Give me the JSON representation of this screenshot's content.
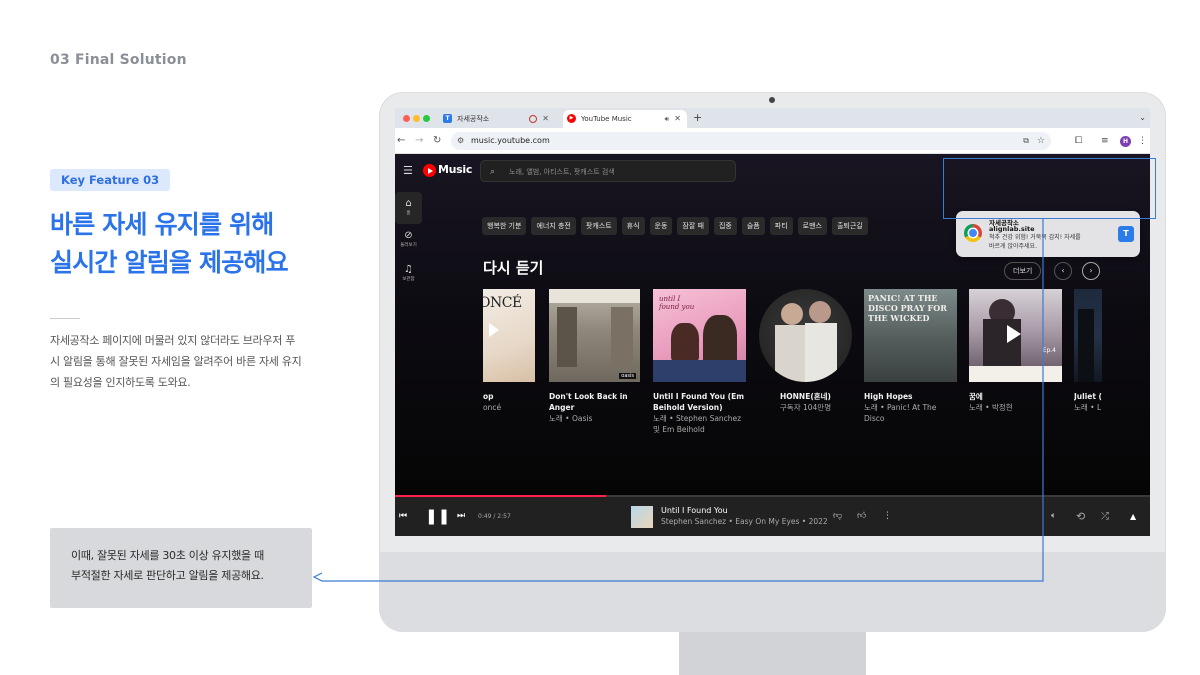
{
  "slide": {
    "section_label": "03  Final Solution",
    "feature_badge": "Key Feature 03",
    "headline": [
      "바른 자세 유지를 위해",
      "실시간 알림을 제공해요"
    ],
    "description": [
      "자세공작소 페이지에 머물러 있지 않더라도 브라우저 푸",
      "시 알림을 통해 잘못된 자세임을 알려주어 바른 자세 유지",
      "의 필요성을 인지하도록 도와요."
    ],
    "callout": [
      "이때, 잘못된 자세를 30초 이상 유지했을 때",
      "부적절한 자세로 판단하고 알림을 제공해요."
    ],
    "accent_color": "#2a73e8"
  },
  "browser": {
    "tabs": [
      {
        "label": "자세공작소",
        "favicon_color": "#2b7be8",
        "favicon_glyph": "T"
      },
      {
        "label": "YouTube Music",
        "favicon_color": "#ff0000",
        "favicon_glyph": "▶"
      }
    ],
    "url": "music.youtube.com",
    "profile_initial": "H"
  },
  "ytmusic": {
    "logo_text": "Music",
    "search_placeholder": "노래, 앨범, 아티스트, 팟캐스트 검색",
    "sidebar": [
      {
        "icon": "home-icon",
        "label": "홈"
      },
      {
        "icon": "explore-icon",
        "label": "둘러보기"
      },
      {
        "icon": "library-icon",
        "label": "보관함"
      }
    ],
    "chips": [
      "행복한 기분",
      "에너지 충전",
      "팟캐스트",
      "휴식",
      "운동",
      "잠잘 때",
      "집중",
      "슬픔",
      "파티",
      "로맨스",
      "출퇴근길"
    ],
    "shelf_title": "다시 듣기",
    "more_label": "더보기",
    "cards": [
      {
        "title": "op",
        "subtitle": "oncé",
        "cover_text": "ONCÉ"
      },
      {
        "title": "Don't Look Back in Anger",
        "subtitle": "노래 • Oasis",
        "cover_text": "oasis"
      },
      {
        "title": "Until I Found You (Em Beihold Version)",
        "subtitle": "노래 • Stephen Sanchez 및 Em Beihold",
        "cover_text": "until I found you"
      },
      {
        "title": "HONNE(혼네)",
        "subtitle": "구독자 104만명",
        "cover_text": ""
      },
      {
        "title": "High Hopes",
        "subtitle": "노래 • Panic! At The Disco",
        "cover_text": "PANIC! AT THE DISCO PRAY FOR THE WICKED"
      },
      {
        "title": "꿈에",
        "subtitle": "노래 • 박정현",
        "cover_text": "Ep.4"
      },
      {
        "title": "Juliet (",
        "subtitle": "노래 • L",
        "cover_text": ""
      }
    ],
    "player": {
      "time": "0:49 / 2:57",
      "title": "Until I Found You",
      "subtitle": "Stephen Sanchez • Easy On My Eyes • 2022",
      "progress": 0.28
    }
  },
  "notification": {
    "app": "자세공작소",
    "site": "alignlab.site",
    "message": [
      "척추 건강 위험! 거북목 감지! 자세를",
      "바르게 앉아주세요."
    ],
    "icon_glyph": "T"
  }
}
